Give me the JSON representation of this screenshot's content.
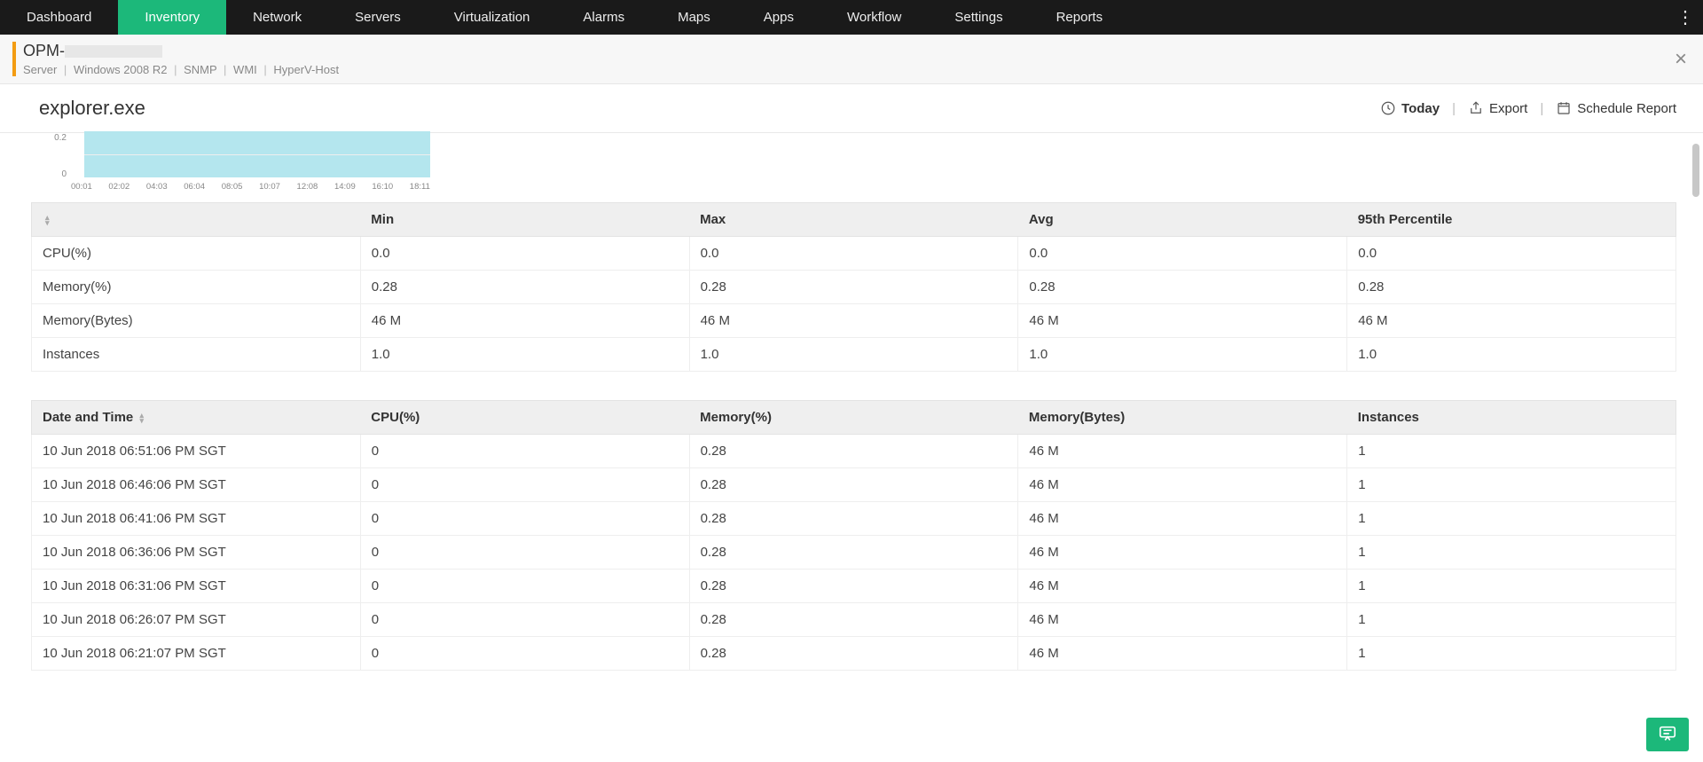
{
  "nav": {
    "items": [
      "Dashboard",
      "Inventory",
      "Network",
      "Servers",
      "Virtualization",
      "Alarms",
      "Maps",
      "Apps",
      "Workflow",
      "Settings",
      "Reports"
    ],
    "active_index": 1
  },
  "subheader": {
    "title_prefix": "OPM-",
    "meta": [
      "Server",
      "Windows 2008 R2",
      "SNMP",
      "WMI",
      "HyperV-Host"
    ]
  },
  "pagebar": {
    "title": "explorer.exe",
    "today_label": "Today",
    "export_label": "Export",
    "schedule_label": "Schedule Report"
  },
  "chart_data": {
    "type": "bar",
    "categories": [
      "00:01",
      "02:02",
      "04:03",
      "06:04",
      "08:05",
      "10:07",
      "12:08",
      "14:09",
      "16:10",
      "18:11"
    ],
    "values": [
      0.28,
      0.28,
      0.28,
      0.28,
      0.28,
      0.28,
      0.28,
      0.28,
      0.28,
      0.28
    ],
    "yticks": [
      "0.2",
      "0"
    ],
    "ylim": [
      0,
      0.3
    ],
    "xlabel": "",
    "ylabel": "",
    "title": ""
  },
  "stats_table": {
    "headers": [
      "",
      "Min",
      "Max",
      "Avg",
      "95th Percentile"
    ],
    "rows": [
      {
        "metric": "CPU(%)",
        "min": "0.0",
        "max": "0.0",
        "avg": "0.0",
        "p95": "0.0"
      },
      {
        "metric": "Memory(%)",
        "min": "0.28",
        "max": "0.28",
        "avg": "0.28",
        "p95": "0.28"
      },
      {
        "metric": "Memory(Bytes)",
        "min": "46 M",
        "max": "46 M",
        "avg": "46 M",
        "p95": "46 M"
      },
      {
        "metric": "Instances",
        "min": "1.0",
        "max": "1.0",
        "avg": "1.0",
        "p95": "1.0"
      }
    ]
  },
  "detail_table": {
    "headers": [
      "Date and Time",
      "CPU(%)",
      "Memory(%)",
      "Memory(Bytes)",
      "Instances"
    ],
    "rows": [
      {
        "dt": "10 Jun 2018 06:51:06 PM SGT",
        "cpu": "0",
        "mem": "0.28",
        "memb": "46 M",
        "inst": "1"
      },
      {
        "dt": "10 Jun 2018 06:46:06 PM SGT",
        "cpu": "0",
        "mem": "0.28",
        "memb": "46 M",
        "inst": "1"
      },
      {
        "dt": "10 Jun 2018 06:41:06 PM SGT",
        "cpu": "0",
        "mem": "0.28",
        "memb": "46 M",
        "inst": "1"
      },
      {
        "dt": "10 Jun 2018 06:36:06 PM SGT",
        "cpu": "0",
        "mem": "0.28",
        "memb": "46 M",
        "inst": "1"
      },
      {
        "dt": "10 Jun 2018 06:31:06 PM SGT",
        "cpu": "0",
        "mem": "0.28",
        "memb": "46 M",
        "inst": "1"
      },
      {
        "dt": "10 Jun 2018 06:26:07 PM SGT",
        "cpu": "0",
        "mem": "0.28",
        "memb": "46 M",
        "inst": "1"
      },
      {
        "dt": "10 Jun 2018 06:21:07 PM SGT",
        "cpu": "0",
        "mem": "0.28",
        "memb": "46 M",
        "inst": "1"
      }
    ]
  }
}
